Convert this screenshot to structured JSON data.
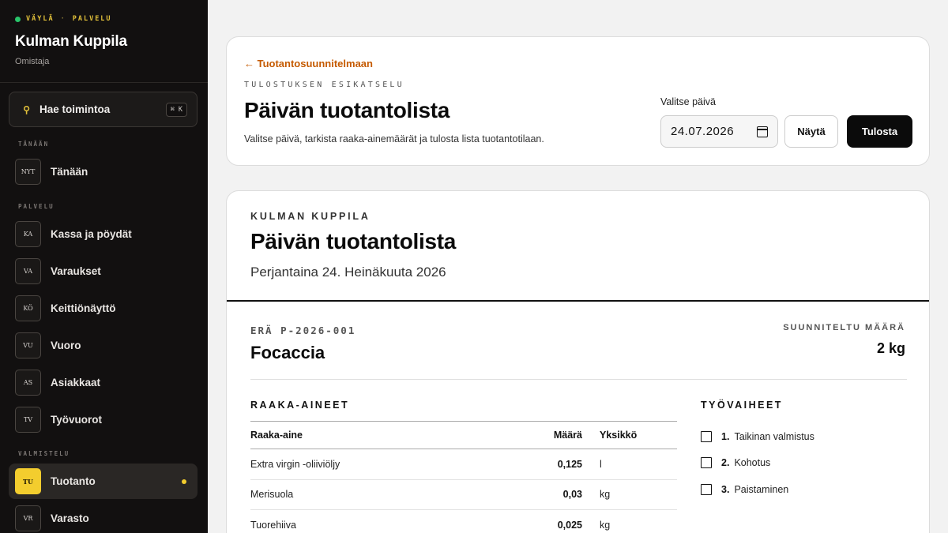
{
  "sidebar": {
    "brand_top_left": "VÄYLÄ",
    "brand_top_sep": "·",
    "brand_top_right": "PALVELU",
    "brand_name": "Kulman Kuppila",
    "brand_role": "Omistaja",
    "search": {
      "label": "Hae toimintoa",
      "shortcut": "⌘ K"
    },
    "sections": {
      "today": "TÄNÄÄN",
      "service": "PALVELU",
      "prep": "VALMISTELU"
    },
    "items": [
      {
        "badge": "NYT",
        "label": "Tänään"
      },
      {
        "badge": "KA",
        "label": "Kassa ja pöydät"
      },
      {
        "badge": "VA",
        "label": "Varaukset"
      },
      {
        "badge": "KÖ",
        "label": "Keittiönäyttö"
      },
      {
        "badge": "VU",
        "label": "Vuoro"
      },
      {
        "badge": "AS",
        "label": "Asiakkaat"
      },
      {
        "badge": "TV",
        "label": "Työvuorot"
      },
      {
        "badge": "TU",
        "label": "Tuotanto",
        "active": true
      },
      {
        "badge": "VR",
        "label": "Varasto"
      }
    ]
  },
  "header": {
    "back_link": "← Tuotantosuunnitelmaan",
    "eyebrow": "TULOSTUKSEN ESIKATSELU",
    "title": "Päivän tuotantolista",
    "subtitle": "Valitse päivä, tarkista raaka-ainemäärät ja tulosta lista tuotantotilaan.",
    "date_label": "Valitse päivä",
    "date_value": "24.07.2026",
    "show_button": "Näytä",
    "print_button": "Tulosta"
  },
  "document": {
    "eyebrow": "KULMAN KUPPILA",
    "title": "Päivän tuotantolista",
    "date": "Perjantaina 24. Heinäkuuta 2026",
    "batch": {
      "label": "ERÄ P-2026-001",
      "name": "Focaccia",
      "amount_label": "SUUNNITELTU MÄÄRÄ",
      "amount_value": "2 kg"
    },
    "ingredients": {
      "heading": "RAAKA-AINEET",
      "columns": {
        "name": "Raaka-aine",
        "qty": "Määrä",
        "unit": "Yksikkö"
      },
      "rows": [
        {
          "name": "Extra virgin -oliiviöljy",
          "qty": "0,125",
          "unit": "l"
        },
        {
          "name": "Merisuola",
          "qty": "0,03",
          "unit": "kg"
        },
        {
          "name": "Tuorehiiva",
          "qty": "0,025",
          "unit": "kg"
        }
      ]
    },
    "steps": {
      "heading": "TYÖVAIHEET",
      "items": [
        {
          "num": "1.",
          "label": "Taikinan valmistus"
        },
        {
          "num": "2.",
          "label": "Kohotus"
        },
        {
          "num": "3.",
          "label": "Paistaminen"
        }
      ]
    }
  }
}
